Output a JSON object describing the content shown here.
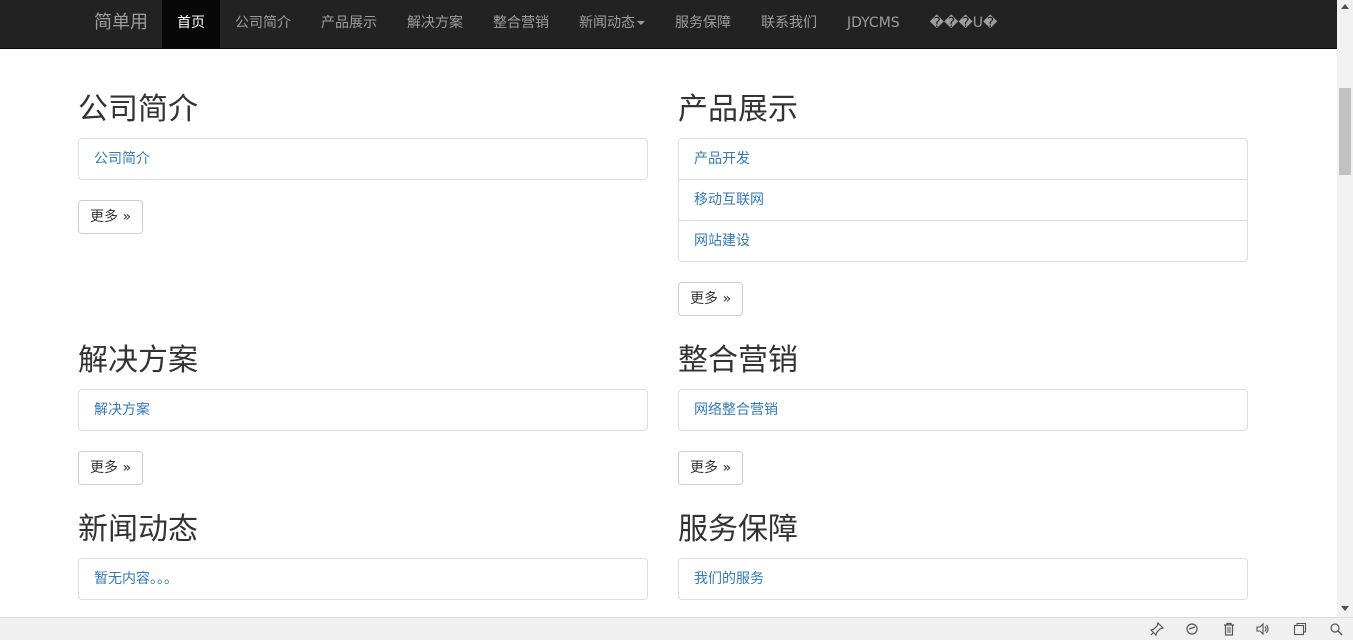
{
  "navbar": {
    "brand": "简单用",
    "items": [
      {
        "label": "首页",
        "active": true
      },
      {
        "label": "公司简介"
      },
      {
        "label": "产品展示"
      },
      {
        "label": "解决方案"
      },
      {
        "label": "整合营销"
      },
      {
        "label": "新闻动态",
        "dropdown": true
      },
      {
        "label": "服务保障"
      },
      {
        "label": "联系我们"
      },
      {
        "label": "JDYCMS"
      },
      {
        "label": "���U�"
      }
    ]
  },
  "sections": {
    "about": {
      "title": "公司简介",
      "items": [
        "公司简介"
      ],
      "more": "更多 »"
    },
    "products": {
      "title": "产品展示",
      "items": [
        "产品开发",
        "移动互联网",
        "网站建设"
      ],
      "more": "更多 »"
    },
    "solutions": {
      "title": "解决方案",
      "items": [
        "解决方案"
      ],
      "more": "更多 »"
    },
    "marketing": {
      "title": "整合营销",
      "items": [
        "网络整合营销"
      ],
      "more": "更多 »"
    },
    "news": {
      "title": "新闻动态",
      "items": [
        "暂无内容。。。"
      ]
    },
    "service": {
      "title": "服务保障",
      "items": [
        "我们的服务"
      ]
    }
  },
  "statusbar": {
    "icons": [
      "pin-icon",
      "refresh-icon",
      "trash-icon",
      "speaker-icon",
      "window-icon",
      "zoom-icon"
    ]
  }
}
